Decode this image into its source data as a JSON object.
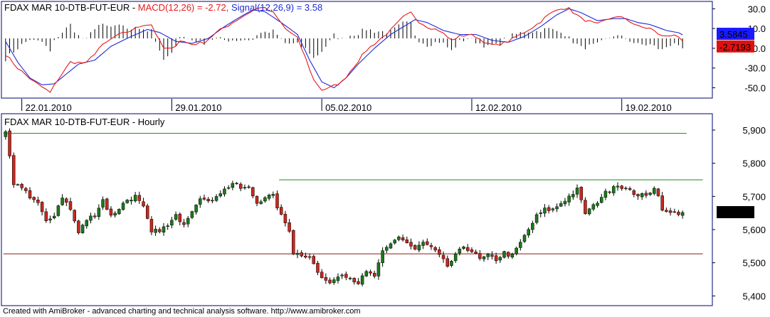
{
  "footer": "Created with AmiBroker - advanced charting and technical analysis software. http://www.amibroker.com",
  "colors": {
    "macd_line": "#e8191a",
    "signal_line": "#1f2bd6",
    "histogram": "#000000",
    "up_body": "#1a7a1a",
    "down_body": "#c8281e",
    "wick": "#000000",
    "resistance": "#1a8a1a",
    "support": "#8b1a1a",
    "frame": "#00007a",
    "signal_badge": "#1a1aff",
    "macd_badge": "#e01010",
    "price_badge": "#000000"
  },
  "chart_data": [
    {
      "type": "line",
      "name": "macd_panel",
      "title": {
        "symbol": "FDAX MAR 10-DTB-FUT-EUR - ",
        "macd": "MACD(12,26) = -2.72, ",
        "signal": "Signal(12,26,9) = 3.58"
      },
      "y_ticks": [
        "30.0",
        "10.0",
        "-10.0",
        "-30.0",
        "-50.0"
      ],
      "y_tick_values": [
        30,
        10,
        -10,
        -30,
        -50
      ],
      "ylim": [
        -59,
        36
      ],
      "x_ticks": [
        {
          "label": "22.01.2010",
          "bar": 4
        },
        {
          "label": "29.01.2010",
          "bar": 41
        },
        {
          "label": "05.02.2010",
          "bar": 78
        },
        {
          "label": "12.02.2010",
          "bar": 115
        },
        {
          "label": "19.02.2010",
          "bar": 152
        }
      ],
      "n_bars": 168,
      "series": [
        {
          "name": "MACD(12,26)",
          "last": -2.72,
          "last_label": "-2.7193",
          "knots": [
            [
              0,
              -16
            ],
            [
              3,
              -30
            ],
            [
              7,
              -44
            ],
            [
              10,
              -52
            ],
            [
              11,
              -55
            ],
            [
              13,
              -41
            ],
            [
              16,
              -24
            ],
            [
              20,
              -25
            ],
            [
              23,
              -10
            ],
            [
              27,
              2
            ],
            [
              31,
              8
            ],
            [
              34,
              14
            ],
            [
              36,
              14
            ],
            [
              38,
              -3
            ],
            [
              39,
              -10
            ],
            [
              41,
              -11
            ],
            [
              43,
              -2
            ],
            [
              46,
              -6
            ],
            [
              49,
              -4
            ],
            [
              52,
              6
            ],
            [
              56,
              16
            ],
            [
              60,
              26
            ],
            [
              63,
              32
            ],
            [
              66,
              26
            ],
            [
              69,
              10
            ],
            [
              72,
              0
            ],
            [
              74,
              -20
            ],
            [
              76,
              -42
            ],
            [
              78,
              -52
            ],
            [
              80,
              -50
            ],
            [
              83,
              -44
            ],
            [
              86,
              -28
            ],
            [
              89,
              -12
            ],
            [
              92,
              -2
            ],
            [
              95,
              8
            ],
            [
              98,
              21
            ],
            [
              100,
              26
            ],
            [
              102,
              17
            ],
            [
              104,
              12
            ],
            [
              107,
              8
            ],
            [
              110,
              -2
            ],
            [
              112,
              2
            ],
            [
              114,
              4
            ],
            [
              116,
              2
            ],
            [
              119,
              -6
            ],
            [
              121,
              -7
            ],
            [
              124,
              -3
            ],
            [
              127,
              4
            ],
            [
              131,
              14
            ],
            [
              134,
              24
            ],
            [
              137,
              31
            ],
            [
              139,
              30
            ],
            [
              142,
              20
            ],
            [
              146,
              14
            ],
            [
              150,
              22
            ],
            [
              153,
              20
            ],
            [
              156,
              12
            ],
            [
              159,
              10
            ],
            [
              162,
              2
            ],
            [
              165,
              4
            ],
            [
              167,
              -4
            ]
          ]
        },
        {
          "name": "Signal(12,26,9)",
          "last": 3.58,
          "last_label": "3.5845",
          "knots": [
            [
              0,
              -3
            ],
            [
              3,
              -24
            ],
            [
              6,
              -40
            ],
            [
              9,
              -47
            ],
            [
              12,
              -46
            ],
            [
              15,
              -36
            ],
            [
              18,
              -26
            ],
            [
              22,
              -22
            ],
            [
              26,
              -8
            ],
            [
              31,
              2
            ],
            [
              35,
              9
            ],
            [
              38,
              6
            ],
            [
              42,
              -3
            ],
            [
              46,
              -5
            ],
            [
              50,
              0
            ],
            [
              54,
              12
            ],
            [
              58,
              22
            ],
            [
              61,
              29
            ],
            [
              64,
              27
            ],
            [
              68,
              16
            ],
            [
              72,
              4
            ],
            [
              75,
              -22
            ],
            [
              78,
              -44
            ],
            [
              81,
              -50
            ],
            [
              84,
              -40
            ],
            [
              87,
              -26
            ],
            [
              91,
              -10
            ],
            [
              95,
              4
            ],
            [
              99,
              14
            ],
            [
              101,
              19
            ],
            [
              104,
              16
            ],
            [
              108,
              8
            ],
            [
              112,
              4
            ],
            [
              116,
              4
            ],
            [
              120,
              -2
            ],
            [
              124,
              -4
            ],
            [
              128,
              2
            ],
            [
              132,
              12
            ],
            [
              136,
              24
            ],
            [
              139,
              30
            ],
            [
              142,
              26
            ],
            [
              146,
              18
            ],
            [
              150,
              20
            ],
            [
              153,
              20
            ],
            [
              156,
              16
            ],
            [
              159,
              14
            ],
            [
              163,
              8
            ],
            [
              167,
              5
            ]
          ]
        }
      ],
      "histogram_note": "MACD minus Signal"
    },
    {
      "type": "candlestick",
      "name": "price_panel",
      "title": "FDAX MAR 10-DTB-FUT-EUR - Hourly",
      "y_ticks": [
        "5,900",
        "5,800",
        "5,700",
        "5,600",
        "5,500",
        "5,400"
      ],
      "y_tick_values": [
        5900,
        5800,
        5700,
        5600,
        5500,
        5400
      ],
      "ylim": [
        5375,
        5945
      ],
      "last_price": 5651.5,
      "last_price_label": "5,651.5",
      "n_bars": 168,
      "close_knots": [
        [
          0,
          5895
        ],
        [
          1,
          5820
        ],
        [
          2,
          5730
        ],
        [
          4,
          5730
        ],
        [
          6,
          5700
        ],
        [
          8,
          5680
        ],
        [
          10,
          5620
        ],
        [
          12,
          5645
        ],
        [
          14,
          5700
        ],
        [
          16,
          5660
        ],
        [
          18,
          5590
        ],
        [
          20,
          5630
        ],
        [
          22,
          5645
        ],
        [
          24,
          5690
        ],
        [
          26,
          5640
        ],
        [
          28,
          5665
        ],
        [
          30,
          5690
        ],
        [
          32,
          5700
        ],
        [
          34,
          5665
        ],
        [
          36,
          5590
        ],
        [
          38,
          5600
        ],
        [
          40,
          5610
        ],
        [
          42,
          5640
        ],
        [
          44,
          5620
        ],
        [
          46,
          5660
        ],
        [
          48,
          5700
        ],
        [
          50,
          5680
        ],
        [
          52,
          5705
        ],
        [
          54,
          5720
        ],
        [
          56,
          5740
        ],
        [
          58,
          5725
        ],
        [
          60,
          5725
        ],
        [
          62,
          5680
        ],
        [
          64,
          5700
        ],
        [
          66,
          5700
        ],
        [
          68,
          5640
        ],
        [
          70,
          5600
        ],
        [
          71,
          5530
        ],
        [
          73,
          5525
        ],
        [
          75,
          5520
        ],
        [
          77,
          5470
        ],
        [
          79,
          5440
        ],
        [
          81,
          5450
        ],
        [
          83,
          5470
        ],
        [
          85,
          5455
        ],
        [
          87,
          5440
        ],
        [
          89,
          5470
        ],
        [
          91,
          5460
        ],
        [
          93,
          5530
        ],
        [
          95,
          5555
        ],
        [
          97,
          5580
        ],
        [
          99,
          5560
        ],
        [
          101,
          5540
        ],
        [
          103,
          5560
        ],
        [
          105,
          5545
        ],
        [
          107,
          5520
        ],
        [
          109,
          5490
        ],
        [
          111,
          5520
        ],
        [
          113,
          5550
        ],
        [
          115,
          5535
        ],
        [
          117,
          5510
        ],
        [
          119,
          5520
        ],
        [
          121,
          5510
        ],
        [
          123,
          5530
        ],
        [
          125,
          5520
        ],
        [
          127,
          5560
        ],
        [
          129,
          5600
        ],
        [
          131,
          5640
        ],
        [
          133,
          5660
        ],
        [
          135,
          5660
        ],
        [
          137,
          5680
        ],
        [
          139,
          5700
        ],
        [
          141,
          5720
        ],
        [
          143,
          5650
        ],
        [
          145,
          5670
        ],
        [
          147,
          5700
        ],
        [
          149,
          5720
        ],
        [
          150,
          5735
        ],
        [
          152,
          5730
        ],
        [
          154,
          5715
        ],
        [
          156,
          5705
        ],
        [
          158,
          5700
        ],
        [
          160,
          5730
        ],
        [
          161,
          5700
        ],
        [
          162,
          5665
        ],
        [
          163,
          5650
        ]
      ],
      "resistance_lines": [
        {
          "value": 5890,
          "from_bar": 0,
          "to_bar": 168
        },
        {
          "value": 5750,
          "from_bar": 68,
          "to_bar": 172
        }
      ],
      "support_lines": [
        {
          "value": 5527,
          "from_bar": 0,
          "to_bar": 172
        }
      ]
    }
  ]
}
